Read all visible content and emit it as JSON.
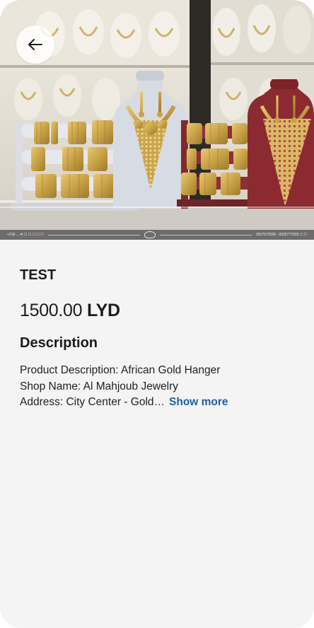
{
  "navigation": {
    "back_icon": "arrow-left-icon"
  },
  "product": {
    "image_alt_icon": "jewelry-display-photo",
    "watermark_left": "+218 ... ✉ ☐ ☐ ☐ ☐ ☐",
    "watermark_right": "0917672028 · 0925777929 ☐ ☐",
    "title": "TEST",
    "price_amount": "1500.00",
    "price_currency": "LYD",
    "description_heading": "Description",
    "description_lines": [
      "Product Description: African Gold Hanger",
      "Shop Name: Al Mahjoub Jewelry",
      "Address: City Center - Gold…"
    ],
    "show_more_label": "Show more"
  },
  "colors": {
    "background": "#f4f4f4",
    "text": "#1c1c1c",
    "link": "#1f5f9e",
    "gold": "#c9a247"
  }
}
